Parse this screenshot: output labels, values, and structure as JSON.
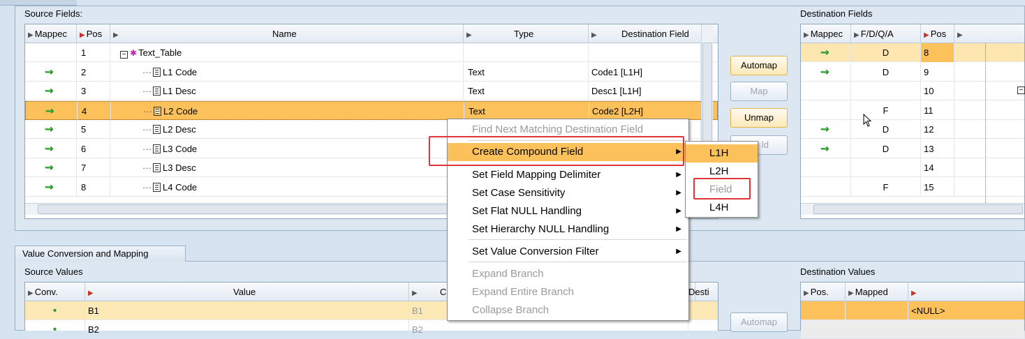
{
  "source_fields": {
    "label": "Source Fields:",
    "headers": {
      "mapped": "Mappec",
      "pos": "Pos",
      "name": "Name",
      "type": "Type",
      "dest": "Destination Field"
    },
    "rows": [
      {
        "pos": "1",
        "name": "Text_Table",
        "type": "",
        "dest": "",
        "mapped": false,
        "root": true
      },
      {
        "pos": "2",
        "name": "L1 Code",
        "type": "Text",
        "dest": "Code1 [L1H]",
        "mapped": true
      },
      {
        "pos": "3",
        "name": "L1 Desc",
        "type": "Text",
        "dest": "Desc1 [L1H]",
        "mapped": true
      },
      {
        "pos": "4",
        "name": "L2 Code",
        "type": "Text",
        "dest": "Code2 [L2H]",
        "mapped": true,
        "selected": true
      },
      {
        "pos": "5",
        "name": "L2 Desc",
        "type": "",
        "dest": "",
        "mapped": true
      },
      {
        "pos": "6",
        "name": "L3 Code",
        "type": "",
        "dest": "",
        "mapped": true
      },
      {
        "pos": "7",
        "name": "L3 Desc",
        "type": "",
        "dest": "",
        "mapped": true
      },
      {
        "pos": "8",
        "name": "L4 Code",
        "type": "",
        "dest": "",
        "mapped": true
      }
    ]
  },
  "buttons": {
    "automap": "Automap",
    "map": "Map",
    "unmap": "Unmap",
    "add_partial": "ld",
    "automap2": "Automap"
  },
  "destination_fields": {
    "label": "Destination Fields",
    "headers": {
      "mapped": "Mappec",
      "fdqa": "F/D/Q/A",
      "pos": "Pos"
    },
    "rows": [
      {
        "mapped": true,
        "fdqa": "D",
        "pos": "8",
        "selected": true
      },
      {
        "mapped": true,
        "fdqa": "D",
        "pos": "9"
      },
      {
        "mapped": false,
        "fdqa": "",
        "pos": "10"
      },
      {
        "mapped": false,
        "fdqa": "F",
        "pos": "11"
      },
      {
        "mapped": true,
        "fdqa": "D",
        "pos": "12"
      },
      {
        "mapped": true,
        "fdqa": "D",
        "pos": "13"
      },
      {
        "mapped": false,
        "fdqa": "",
        "pos": "14"
      },
      {
        "mapped": false,
        "fdqa": "F",
        "pos": "15"
      }
    ]
  },
  "context_menu": {
    "items": [
      {
        "label": "Find Next Matching Destination Field",
        "disabled": true
      },
      {
        "label": "Create Compound Field",
        "highlighted": true,
        "submenu": true
      },
      {
        "label": "Set Field Mapping Delimiter",
        "submenu": true
      },
      {
        "label": "Set Case Sensitivity",
        "submenu": true
      },
      {
        "label": "Set Flat NULL Handling",
        "submenu": true
      },
      {
        "label": "Set Hierarchy NULL Handling",
        "submenu": true
      },
      {
        "label": "Set Value Conversion Filter",
        "submenu": true
      },
      {
        "label": "Expand Branch",
        "disabled": true
      },
      {
        "label": "Expand Entire Branch",
        "disabled": true
      },
      {
        "label": "Collapse Branch",
        "disabled": true
      }
    ]
  },
  "submenu": {
    "items": [
      {
        "label": "L1H",
        "highlighted": true
      },
      {
        "label": "L2H"
      },
      {
        "label": "Field",
        "disabled": true
      },
      {
        "label": "L4H"
      }
    ]
  },
  "value_conversion": {
    "tab": "Value Conversion and Mapping",
    "source_label": "Source Values",
    "headers": {
      "conv": "Conv.",
      "value": "Value",
      "c": "C",
      "dest": "Desti"
    },
    "rows": [
      {
        "value": "B1",
        "c": "B1"
      },
      {
        "value": "B2",
        "c": "B2"
      }
    ],
    "dest_label": "Destination Values",
    "dest_headers": {
      "pos": "Pos.",
      "mapped": "Mapped"
    },
    "dest_rows": [
      {
        "value": "<NULL>"
      }
    ]
  },
  "colors": {
    "selection": "#fcc15a",
    "mapped_icon": "#2a9d2a",
    "highlight_box": "#e0343a"
  }
}
